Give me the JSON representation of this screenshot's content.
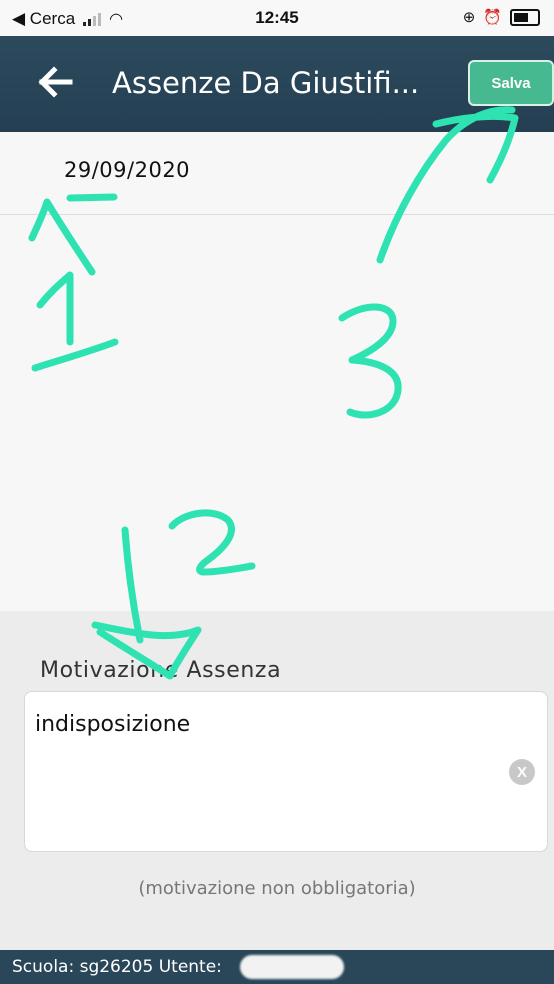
{
  "status_bar": {
    "carrier_back": "◀ Cerca",
    "time": "12:45",
    "icons": [
      "signal-icon",
      "wifi-icon",
      "lock-rotation-icon",
      "alarm-icon",
      "battery-icon"
    ]
  },
  "header": {
    "title": "Assenze Da Giustifi...",
    "save_label": "Salva",
    "back_icon": "arrow-left-icon"
  },
  "date": {
    "value": "29/09/2020"
  },
  "motivation": {
    "label": "Motivazione Assenza",
    "value": "indisposizione",
    "clear_label": "X",
    "note": "(motivazione non obbligatoria)"
  },
  "footer": {
    "text": "Scuola: sg26205 Utente:"
  },
  "annotations": {
    "labels": [
      "1",
      "2",
      "3"
    ]
  },
  "colors": {
    "header_bg": "#2d4a5d",
    "save_button": "#46b991",
    "annotation": "#2ee2b2",
    "footer_bg": "#2a4759"
  }
}
